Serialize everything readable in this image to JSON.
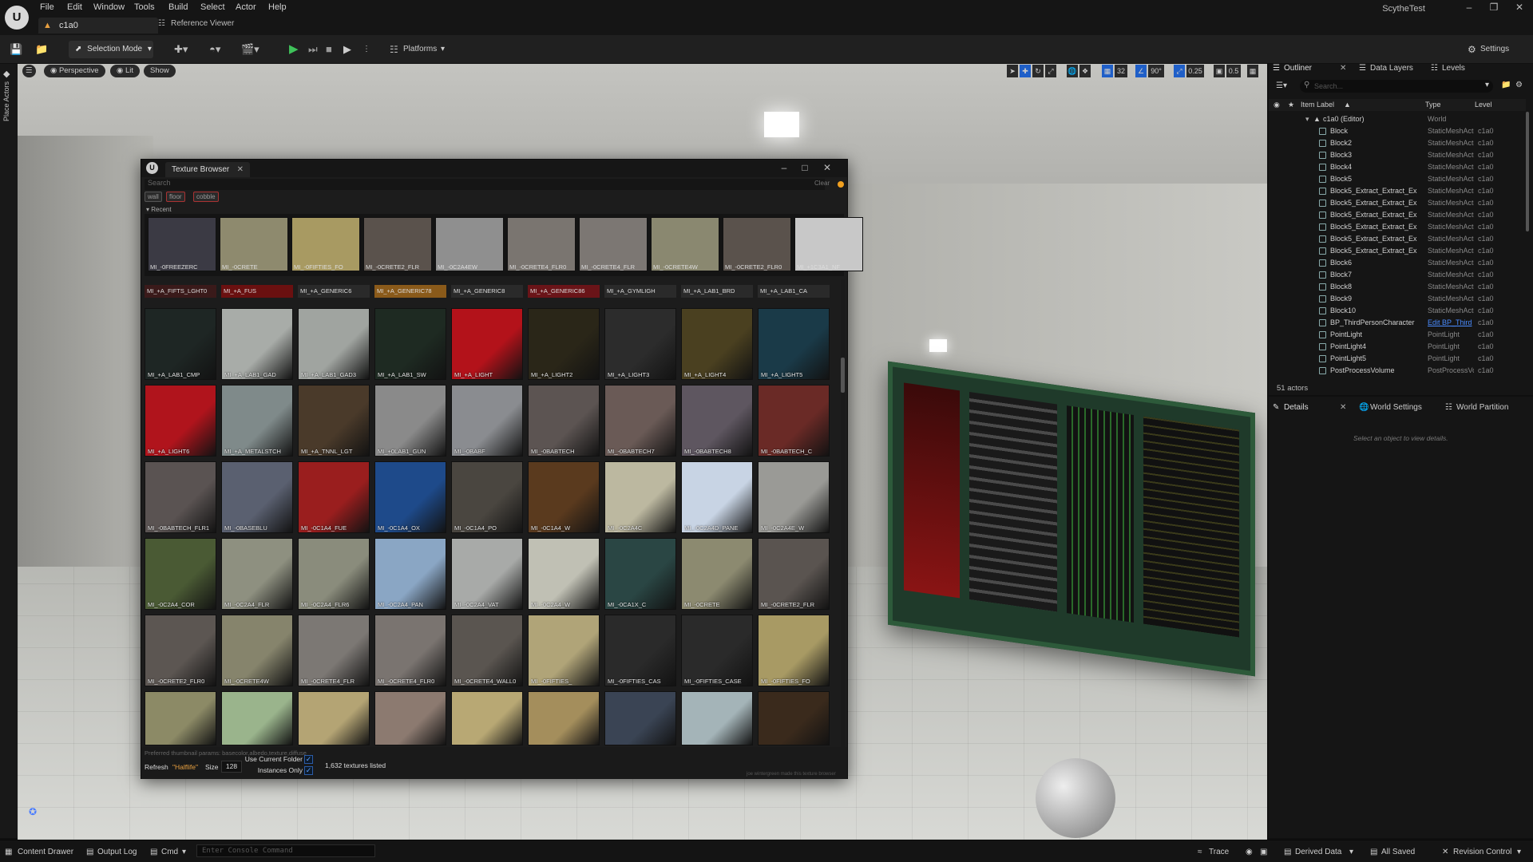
{
  "menubar": {
    "logo": "U",
    "items": [
      "File",
      "Edit",
      "Window",
      "Tools",
      "Build",
      "Select",
      "Actor",
      "Help"
    ],
    "app_title": "ScytheTest",
    "doc_tab": "c1a0",
    "reference_viewer": "Reference Viewer"
  },
  "toolbar": {
    "selection_mode": "Selection Mode",
    "platforms": "Platforms",
    "settings": "Settings"
  },
  "left_strip": {
    "place_actors": "Place Actors"
  },
  "viewport": {
    "perspective": "Perspective",
    "lit": "Lit",
    "show": "Show",
    "grid_size": "32",
    "rotation_snap": "90°",
    "scale_snap": "0.25",
    "camera_speed": "0.5"
  },
  "texture_browser": {
    "title": "Texture Browser",
    "search_placeholder": "Search",
    "clear": "Clear",
    "filters": [
      "wall",
      "floor",
      "cobble"
    ],
    "recent_label": "Recent",
    "recent": [
      {
        "label": "MI_-0FREEZERC",
        "color": "#3b3a44"
      },
      {
        "label": "MI_-0CRETE",
        "color": "#8e8a6e"
      },
      {
        "label": "MI_-0FIFTIES_FO",
        "color": "#a89a62"
      },
      {
        "label": "MI_-0CRETE2_FLR",
        "color": "#5a524c"
      },
      {
        "label": "MI_-0C2A4EW",
        "color": "#8f8f8f"
      },
      {
        "label": "MI_-0CRETE4_FLR0",
        "color": "#7a7570"
      },
      {
        "label": "MI_-0CRETE4_FLR",
        "color": "#7c7773"
      },
      {
        "label": "MI_-0CRETE4W",
        "color": "#8a8870"
      },
      {
        "label": "MI_-0CRETE2_FLR0",
        "color": "#5a524c"
      },
      {
        "label": "MI_+1C3A1_NF",
        "color": "#c8c8c8"
      }
    ],
    "partial_row": [
      "MI_+A_FIFTS_LGHT0",
      "MI_+A_FUS",
      "MI_+A_GENERIC6",
      "MI_+A_GENERIC78",
      "MI_+A_GENERIC8",
      "MI_+A_GENERIC86",
      "MI_+A_GYMLIGH",
      "MI_+A_LAB1_BRD",
      "MI_+A_LAB1_CA"
    ],
    "rows": [
      [
        {
          "label": "MI_+A_LAB1_CMP",
          "color": "#1e2624"
        },
        {
          "label": "MI_+A_LAB1_GAD",
          "color": "#a8aca8"
        },
        {
          "label": "MI_+A_LAB1_GAD3",
          "color": "#a0a4a0"
        },
        {
          "label": "MI_+A_LAB1_SW",
          "color": "#1e2a22"
        },
        {
          "label": "MI_+A_LIGHT",
          "color": "#b3121a"
        },
        {
          "label": "MI_+A_LIGHT2",
          "color": "#2a2618"
        },
        {
          "label": "MI_+A_LIGHT3",
          "color": "#2c2c2c"
        },
        {
          "label": "MI_+A_LIGHT4",
          "color": "#4a4020"
        },
        {
          "label": "MI_+A_LIGHT5",
          "color": "#1a3a48"
        }
      ],
      [
        {
          "label": "MI_+A_LIGHT6",
          "color": "#b0141c"
        },
        {
          "label": "MI_+A_METALSTCH",
          "color": "#7f8a8a"
        },
        {
          "label": "MI_+A_TNNL_LGT",
          "color": "#4a3a2a"
        },
        {
          "label": "MI_+0LAB1_GUN",
          "color": "#8a8a8a"
        },
        {
          "label": "MI_-0BABF",
          "color": "#8a8c90"
        },
        {
          "label": "MI_-0BABTECH",
          "color": "#5c5452"
        },
        {
          "label": "MI_-0BABTECH7",
          "color": "#6a5a56"
        },
        {
          "label": "MI_-0BABTECH8",
          "color": "#5e5660"
        },
        {
          "label": "MI_-0BABTECH_C",
          "color": "#6a2a26"
        }
      ],
      [
        {
          "label": "MI_-0BABTECH_FLR1",
          "color": "#5a5352"
        },
        {
          "label": "MI_-0BASEBLU",
          "color": "#5a6070"
        },
        {
          "label": "MI_-0C1A4_FUE",
          "color": "#9a1e1e"
        },
        {
          "label": "MI_-0C1A4_OX",
          "color": "#1e4a8a"
        },
        {
          "label": "MI_-0C1A4_PO",
          "color": "#4a4640"
        },
        {
          "label": "MI_-0C1A4_W",
          "color": "#5a3a1e"
        },
        {
          "label": "MI_-0C2A4C",
          "color": "#bcb8a0"
        },
        {
          "label": "MI_-0C2A4D_PANE",
          "color": "#c8d4e4"
        },
        {
          "label": "MI_-0C2A4E_W",
          "color": "#9a9a96"
        }
      ],
      [
        {
          "label": "MI_-0C2A4_COR",
          "color": "#4a5a34"
        },
        {
          "label": "MI_-0C2A4_FLR",
          "color": "#8e9080"
        },
        {
          "label": "MI_-0C2A4_FLR6",
          "color": "#8a8c7c"
        },
        {
          "label": "MI_-0C2A4_PAN",
          "color": "#8aa6c4"
        },
        {
          "label": "MI_-0C2A4_VAT",
          "color": "#a8aaa8"
        },
        {
          "label": "MI_-0C2A4_W",
          "color": "#c0c0b4"
        },
        {
          "label": "MI_-0CA1X_C",
          "color": "#2a4644"
        },
        {
          "label": "MI_-0CRETE",
          "color": "#8c8a70"
        },
        {
          "label": "MI_-0CRETE2_FLR",
          "color": "#5a5450"
        }
      ],
      [
        {
          "label": "MI_-0CRETE2_FLR0",
          "color": "#5c5652"
        },
        {
          "label": "MI_-0CRETE4W",
          "color": "#86846c"
        },
        {
          "label": "MI_-0CRETE4_FLR",
          "color": "#7c7874"
        },
        {
          "label": "MI_-0CRETE4_FLR0",
          "color": "#7a7470"
        },
        {
          "label": "MI_-0CRETE4_WALL0",
          "color": "#5a5550"
        },
        {
          "label": "MI_-0FIFTIES_",
          "color": "#b0a478"
        },
        {
          "label": "MI_-0FIFTIES_CAS",
          "color": "#2a2a2a"
        },
        {
          "label": "MI_-0FIFTIES_CASE",
          "color": "#2a2a2a"
        },
        {
          "label": "MI_-0FIFTIES_FO",
          "color": "#a89a64"
        }
      ],
      [
        {
          "label": "",
          "color": "#8c8a66"
        },
        {
          "label": "",
          "color": "#9ab48c"
        },
        {
          "label": "",
          "color": "#b4a474"
        },
        {
          "label": "",
          "color": "#8c7a70"
        },
        {
          "label": "",
          "color": "#b8a874"
        },
        {
          "label": "",
          "color": "#a48e5c"
        },
        {
          "label": "",
          "color": "#3a4454"
        },
        {
          "label": "",
          "color": "#a4b4b8"
        },
        {
          "label": "",
          "color": "#3a2a1c"
        }
      ]
    ],
    "preferred_params": "Preferred thumbnail params: basecolor,albedo,texture,diffuse",
    "refresh": "Refresh",
    "folder": "\"Halflife\"",
    "size_label": "Size",
    "size_value": "128",
    "use_current_folder": "Use Current Folder",
    "instances_only": "Instances Only",
    "count": "1,632 textures listed",
    "credit": "joe wintergreen made this texture browser"
  },
  "outliner": {
    "tabs": [
      "Outliner",
      "Data Layers",
      "Levels"
    ],
    "search_placeholder": "Search...",
    "headers": {
      "label": "Item Label",
      "type": "Type",
      "level": "Level"
    },
    "root": {
      "label": "c1a0 (Editor)",
      "type": "World"
    },
    "rows": [
      {
        "label": "Block",
        "type": "StaticMeshActor",
        "level": "c1a0"
      },
      {
        "label": "Block2",
        "type": "StaticMeshActor",
        "level": "c1a0"
      },
      {
        "label": "Block3",
        "type": "StaticMeshActor",
        "level": "c1a0"
      },
      {
        "label": "Block4",
        "type": "StaticMeshActor",
        "level": "c1a0"
      },
      {
        "label": "Block5",
        "type": "StaticMeshActor",
        "level": "c1a0"
      },
      {
        "label": "Block5_Extract_Extract_Ex",
        "type": "StaticMeshActor",
        "level": "c1a0"
      },
      {
        "label": "Block5_Extract_Extract_Ex",
        "type": "StaticMeshActor",
        "level": "c1a0"
      },
      {
        "label": "Block5_Extract_Extract_Ex",
        "type": "StaticMeshActor",
        "level": "c1a0"
      },
      {
        "label": "Block5_Extract_Extract_Ex",
        "type": "StaticMeshActor",
        "level": "c1a0"
      },
      {
        "label": "Block5_Extract_Extract_Ex",
        "type": "StaticMeshActor",
        "level": "c1a0"
      },
      {
        "label": "Block5_Extract_Extract_Ex",
        "type": "StaticMeshActor",
        "level": "c1a0"
      },
      {
        "label": "Block6",
        "type": "StaticMeshActor",
        "level": "c1a0"
      },
      {
        "label": "Block7",
        "type": "StaticMeshActor",
        "level": "c1a0"
      },
      {
        "label": "Block8",
        "type": "StaticMeshActor",
        "level": "c1a0"
      },
      {
        "label": "Block9",
        "type": "StaticMeshActor",
        "level": "c1a0"
      },
      {
        "label": "Block10",
        "type": "StaticMeshActor",
        "level": "c1a0"
      },
      {
        "label": "BP_ThirdPersonCharacter",
        "type": "Edit BP_Third",
        "level": "c1a0"
      },
      {
        "label": "PointLight",
        "type": "PointLight",
        "level": "c1a0"
      },
      {
        "label": "PointLight4",
        "type": "PointLight",
        "level": "c1a0"
      },
      {
        "label": "PointLight5",
        "type": "PointLight",
        "level": "c1a0"
      },
      {
        "label": "PostProcessVolume",
        "type": "PostProcessVolume",
        "level": "c1a0"
      }
    ],
    "actors_count": "51 actors"
  },
  "details": {
    "tabs": [
      "Details",
      "World Settings",
      "World Partition"
    ],
    "empty": "Select an object to view details."
  },
  "statusbar": {
    "content_drawer": "Content Drawer",
    "output_log": "Output Log",
    "cmd": "Cmd",
    "console_placeholder": "Enter Console Command",
    "trace": "Trace",
    "derived_data": "Derived Data",
    "all_saved": "All Saved",
    "revision_control": "Revision Control"
  }
}
